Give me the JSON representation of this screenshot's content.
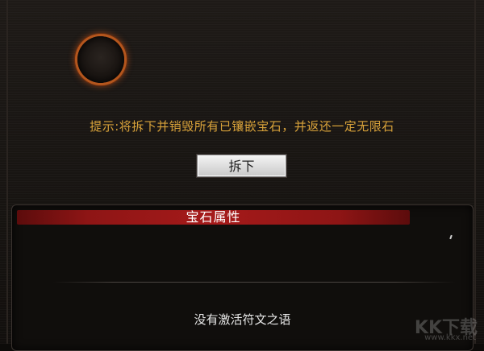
{
  "hint_text": "提示:将拆下并销毁所有已镶嵌宝石，并返还一定无限石",
  "remove_button_label": "拆下",
  "attributes_panel": {
    "title": "宝石属性",
    "empty_message": "没有激活符文之语"
  },
  "watermark": {
    "logo_text": "KK下载",
    "url_text": "www.kkx.net"
  },
  "colors": {
    "hint": "#d8a23a",
    "header_red": "#a51a1a",
    "slot_glow": "#b4561d"
  }
}
